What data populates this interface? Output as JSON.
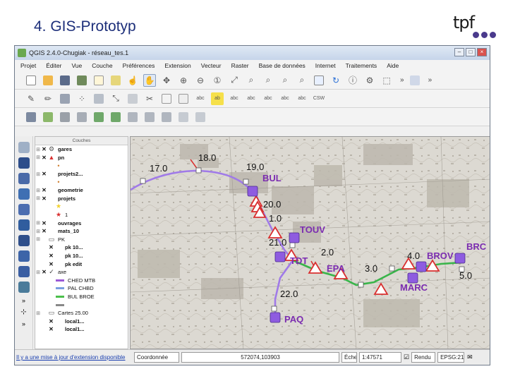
{
  "slide": {
    "title": "4. GIS-Prototyp",
    "brand": "tpf"
  },
  "window": {
    "title": "QGIS 2.4.0-Chugiak - réseau_tes.1",
    "menu": [
      "Projet",
      "Éditer",
      "Vue",
      "Couche",
      "Préférences",
      "Extension",
      "Vecteur",
      "Raster",
      "Base de données",
      "Internet",
      "Traitements",
      "Aide"
    ]
  },
  "layers_panel": {
    "header": "Couches",
    "items": [
      {
        "label": "gares",
        "bold": true,
        "checked": true,
        "indent": 0,
        "icon": "gear-icon"
      },
      {
        "label": "pn",
        "bold": true,
        "checked": true,
        "indent": 0,
        "icon": "warning-icon"
      },
      {
        "label": "",
        "bold": false,
        "checked": false,
        "indent": 1,
        "icon": "dot-icon"
      },
      {
        "label": "projets2...",
        "bold": true,
        "checked": true,
        "indent": 0,
        "icon": "line-icon"
      },
      {
        "label": "",
        "bold": false,
        "checked": false,
        "indent": 1,
        "icon": "dot-icon"
      },
      {
        "label": "geometrie",
        "bold": true,
        "checked": true,
        "indent": 0,
        "icon": "line-icon"
      },
      {
        "label": "projets",
        "bold": true,
        "checked": true,
        "indent": 0,
        "icon": "line-icon"
      },
      {
        "label": "",
        "bold": false,
        "checked": false,
        "indent": 1,
        "icon": "star-yellow-icon"
      },
      {
        "label": "1",
        "bold": false,
        "checked": false,
        "indent": 1,
        "icon": "star-red-icon"
      },
      {
        "label": "ouvrages",
        "bold": true,
        "checked": true,
        "indent": 0,
        "icon": "line-icon"
      },
      {
        "label": "mats_10",
        "bold": true,
        "checked": true,
        "indent": 0,
        "icon": "line-icon"
      },
      {
        "label": "PK",
        "bold": false,
        "checked": false,
        "indent": 0,
        "icon": "folder-icon"
      },
      {
        "label": "pk 10...",
        "bold": true,
        "checked": true,
        "indent": 1,
        "icon": "line-icon"
      },
      {
        "label": "pk 10...",
        "bold": true,
        "checked": true,
        "indent": 1,
        "icon": "line-icon"
      },
      {
        "label": "pk edit",
        "bold": true,
        "checked": true,
        "indent": 1,
        "icon": "line-icon"
      },
      {
        "label": "axe",
        "bold": false,
        "checked": true,
        "indent": 0,
        "icon": "check-icon"
      },
      {
        "label": "CHED MTB",
        "bold": false,
        "checked": false,
        "indent": 1,
        "icon": "swatch",
        "color": "#9b59d6"
      },
      {
        "label": "PAL CHBD",
        "bold": false,
        "checked": false,
        "indent": 1,
        "icon": "swatch",
        "color": "#7a9ee0"
      },
      {
        "label": "BUL BROE",
        "bold": false,
        "checked": false,
        "indent": 1,
        "icon": "swatch",
        "color": "#4bbf4b"
      },
      {
        "label": "",
        "bold": false,
        "checked": false,
        "indent": 1,
        "icon": "swatch",
        "color": "#888888"
      },
      {
        "label": "Cartes 25.00",
        "bold": false,
        "checked": false,
        "indent": 0,
        "icon": "folder-icon"
      },
      {
        "label": "local1...",
        "bold": true,
        "checked": true,
        "indent": 1,
        "icon": "line-icon"
      },
      {
        "label": "local1...",
        "bold": true,
        "checked": true,
        "indent": 1,
        "icon": "line-icon"
      }
    ]
  },
  "map": {
    "labels_black": [
      "17.0",
      "18.0",
      "19.0",
      "20.0",
      "1.0",
      "21.0",
      "2.0",
      "22.0",
      "3.0",
      "4.0",
      "5.0"
    ],
    "labels_purple": [
      "BUL",
      "TOUV",
      "TDT",
      "EPA",
      "BROV",
      "BRC",
      "MARC",
      "PAQ"
    ],
    "colors": {
      "purple_line": "#a07ae8",
      "green_line": "#39b54a",
      "red_line": "#d93030",
      "label_purple": "#7b2cb0"
    }
  },
  "statusbar": {
    "message": "Il y a une mise à jour d'extension disponible",
    "coord_label": "Coordonnée",
    "coord_value": "572074,103903",
    "scale_label": "Échelle",
    "scale_value": "1:47571",
    "render_label": "Rendu",
    "epsg": "EPSG:21781"
  }
}
